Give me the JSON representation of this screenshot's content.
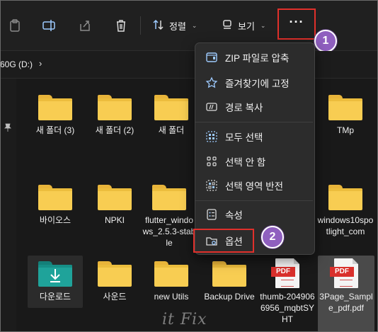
{
  "toolbar": {
    "sort_label": "정렬",
    "view_label": "보기",
    "more_label": "···"
  },
  "address": {
    "path": "60G (D:)",
    "chevron": "›"
  },
  "files": [
    {
      "name": "새 폴더 (3)",
      "type": "folder"
    },
    {
      "name": "새 폴더 (2)",
      "type": "folder"
    },
    {
      "name": "새 폴더",
      "type": "folder"
    },
    {
      "name": "TMp",
      "type": "folder"
    },
    {
      "name": "바이오스",
      "type": "folder"
    },
    {
      "name": "NPKI",
      "type": "folder"
    },
    {
      "name": "flutter_windows_2.5.3-stable",
      "type": "folder"
    },
    {
      "name": "windows10spotlight_com",
      "type": "folder"
    },
    {
      "name": "다운로드",
      "type": "downloads-folder"
    },
    {
      "name": "사운드",
      "type": "folder"
    },
    {
      "name": "new Utils",
      "type": "folder"
    },
    {
      "name": "Backup Drive",
      "type": "folder"
    },
    {
      "name": "thumb-2049066956_mqbtSYHT",
      "type": "pdf"
    },
    {
      "name": "3Page_Sample_pdf.pdf",
      "type": "pdf"
    }
  ],
  "menu": {
    "items": [
      {
        "label": "ZIP 파일로 압축",
        "icon": "zip-icon"
      },
      {
        "label": "즐겨찾기에 고정",
        "icon": "star-icon"
      },
      {
        "label": "경로 복사",
        "icon": "copy-path-icon"
      },
      {
        "label": "모두 선택",
        "icon": "select-all-icon"
      },
      {
        "label": "선택 안 함",
        "icon": "select-none-icon"
      },
      {
        "label": "선택 영역 반전",
        "icon": "invert-selection-icon"
      },
      {
        "label": "속성",
        "icon": "properties-icon"
      },
      {
        "label": "옵션",
        "icon": "options-icon"
      }
    ]
  },
  "annotations": {
    "badge1": "1",
    "badge2": "2"
  },
  "pdf_tag": "PDF",
  "watermark": "it Fix",
  "colors": {
    "background": "#191919",
    "folder": "#f8cd52",
    "downloads_folder": "#1fa39a",
    "highlight_box": "#e0302b",
    "badge": "#8f5fbf",
    "pdf_tag": "#d9302c"
  }
}
